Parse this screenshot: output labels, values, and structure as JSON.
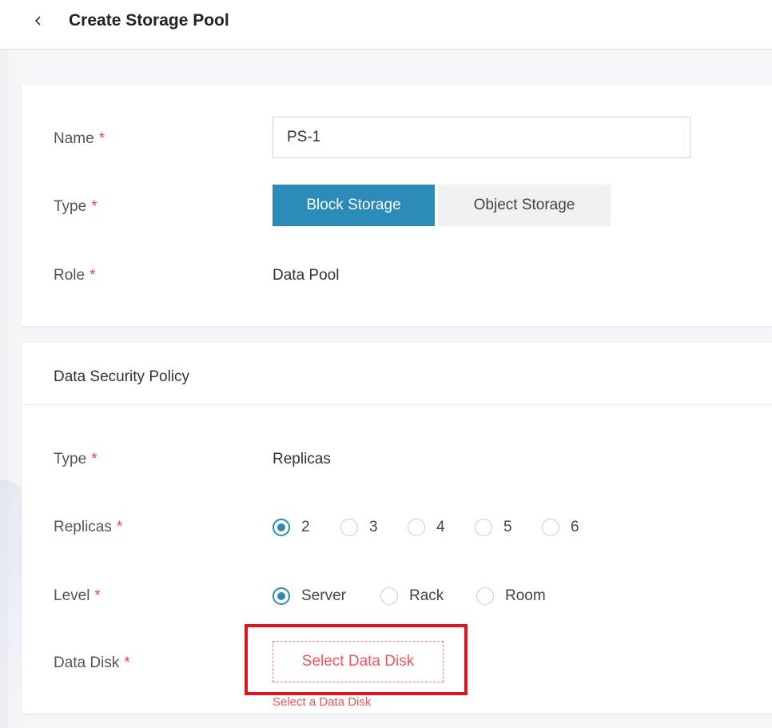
{
  "header": {
    "back_icon": "chevron-left-icon",
    "title": "Create Storage Pool"
  },
  "basic": {
    "name_label": "Name",
    "name_value": "PS-1",
    "type_label": "Type",
    "type_options": [
      "Block Storage",
      "Object Storage"
    ],
    "type_selected": "Block Storage",
    "role_label": "Role",
    "role_value": "Data Pool",
    "required_mark": "*"
  },
  "security": {
    "section_title": "Data Security Policy",
    "type_label": "Type",
    "type_value": "Replicas",
    "replicas_label": "Replicas",
    "replicas_options": [
      "2",
      "3",
      "4",
      "5",
      "6"
    ],
    "replicas_selected": "2",
    "level_label": "Level",
    "level_options": [
      "Server",
      "Rack",
      "Room"
    ],
    "level_selected": "Server",
    "data_disk_label": "Data Disk",
    "select_disk_button": "Select Data Disk",
    "error_message": "Select a Data Disk"
  },
  "colors": {
    "accent": "#2b8ab7",
    "required": "#e0474c",
    "error": "#f0545a",
    "highlight": "#e0141c"
  }
}
